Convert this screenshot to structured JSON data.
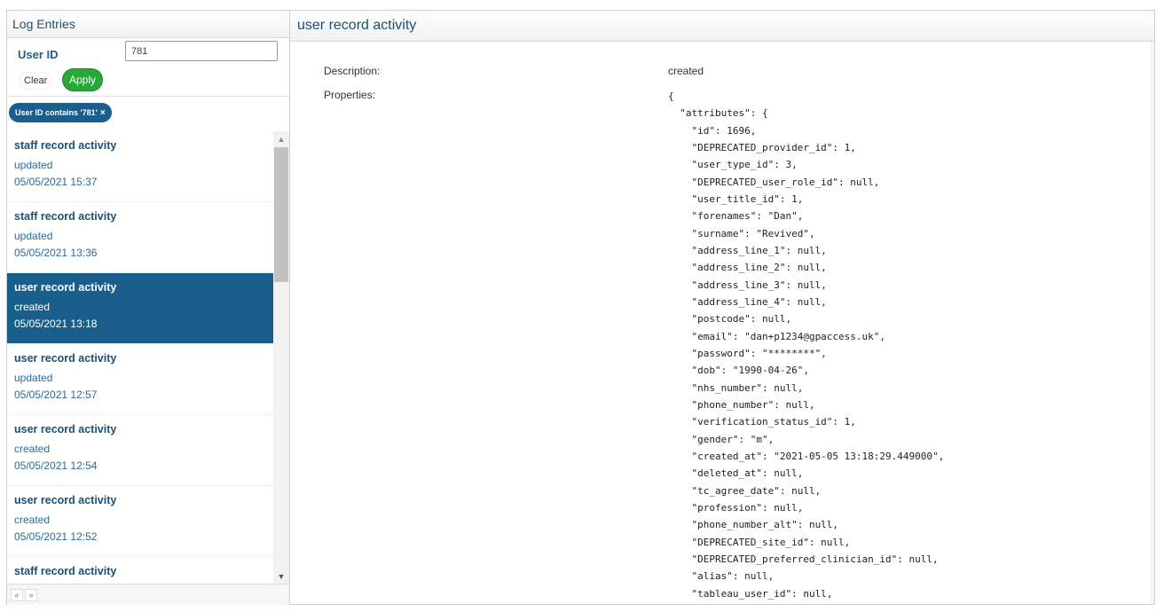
{
  "left": {
    "title": "Log Entries",
    "filter": {
      "label": "User ID",
      "value": "781",
      "clear_label": "Clear",
      "apply_label": "Apply"
    },
    "active_filter": "User ID contains '781'",
    "active_filter_close": "×",
    "entries": [
      {
        "title": "staff record activity",
        "desc": "updated",
        "date": "05/05/2021 15:37"
      },
      {
        "title": "staff record activity",
        "desc": "updated",
        "date": "05/05/2021 13:36"
      },
      {
        "title": "user record activity",
        "desc": "created",
        "date": "05/05/2021 13:18"
      },
      {
        "title": "user record activity",
        "desc": "updated",
        "date": "05/05/2021 12:57"
      },
      {
        "title": "user record activity",
        "desc": "created",
        "date": "05/05/2021 12:54"
      },
      {
        "title": "user record activity",
        "desc": "created",
        "date": "05/05/2021 12:52"
      },
      {
        "title": "staff record activity",
        "desc": "",
        "date": ""
      }
    ],
    "selected_index": 2,
    "pager": {
      "prev": "«",
      "next": "»"
    }
  },
  "right": {
    "title": "user record activity",
    "description_label": "Description:",
    "description_value": "created",
    "properties_label": "Properties:",
    "properties_lines": [
      "{",
      "  \"attributes\": {",
      "    \"id\": 1696,",
      "    \"DEPRECATED_provider_id\": 1,",
      "    \"user_type_id\": 3,",
      "    \"DEPRECATED_user_role_id\": null,",
      "    \"user_title_id\": 1,",
      "    \"forenames\": \"Dan\",",
      "    \"surname\": \"Revived\",",
      "    \"address_line_1\": null,",
      "    \"address_line_2\": null,",
      "    \"address_line_3\": null,",
      "    \"address_line_4\": null,",
      "    \"postcode\": null,",
      "    \"email\": \"dan+p1234@gpaccess.uk\",",
      "    \"password\": \"********\",",
      "    \"dob\": \"1990-04-26\",",
      "    \"nhs_number\": null,",
      "    \"phone_number\": null,",
      "    \"verification_status_id\": 1,",
      "    \"gender\": \"m\",",
      "    \"created_at\": \"2021-05-05 13:18:29.449000\",",
      "    \"deleted_at\": null,",
      "    \"tc_agree_date\": null,",
      "    \"profession\": null,",
      "    \"phone_number_alt\": null,",
      "    \"DEPRECATED_site_id\": null,",
      "    \"DEPRECATED_preferred_clinician_id\": null,",
      "    \"alias\": null,",
      "    \"tableau_user_id\": null,"
    ]
  }
}
